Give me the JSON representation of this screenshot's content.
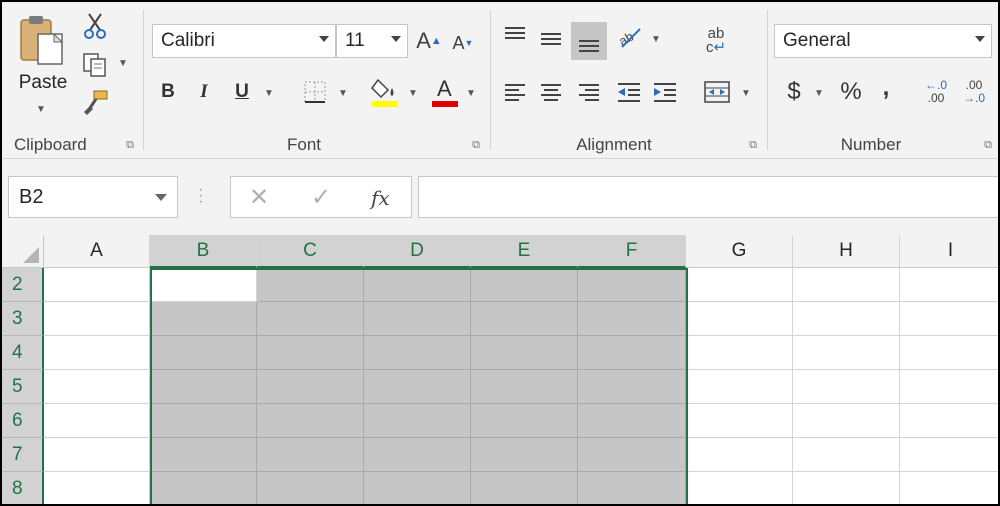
{
  "ribbon": {
    "clipboard": {
      "paste_label": "Paste",
      "group_label": "Clipboard",
      "icons": [
        "paste-icon",
        "cut-icon",
        "copy-icon",
        "format-painter-icon"
      ]
    },
    "font": {
      "group_label": "Font",
      "font_name": "Calibri",
      "font_size": "11",
      "bold": "B",
      "italic": "I",
      "underline": "U",
      "font_color": "#e00000",
      "fill_color": "#ffff00"
    },
    "alignment": {
      "group_label": "Alignment"
    },
    "number": {
      "group_label": "Number",
      "format": "General",
      "currency": "$",
      "percent": "%",
      "comma": ",",
      "inc_decimal": ".00",
      "dec_decimal": ".00"
    }
  },
  "formula_bar": {
    "name_box": "B2",
    "cancel": "✕",
    "enter": "✓",
    "fx": "fx",
    "formula": ""
  },
  "grid": {
    "columns": [
      "A",
      "B",
      "C",
      "D",
      "E",
      "F",
      "G",
      "H",
      "I"
    ],
    "rows": [
      "2",
      "3",
      "4",
      "5",
      "6",
      "7",
      "8"
    ],
    "selection": "B2:F8",
    "active_cell": "B2",
    "accent_color": "#217346"
  }
}
